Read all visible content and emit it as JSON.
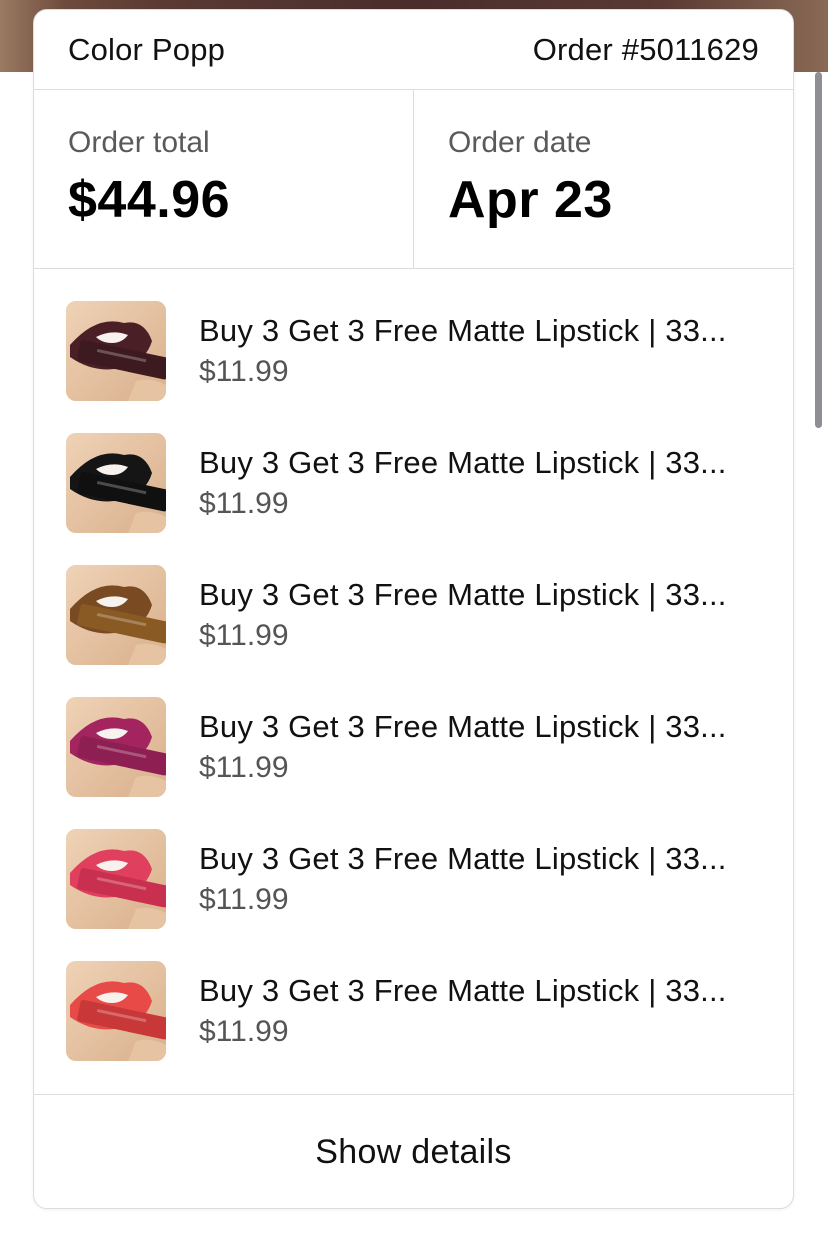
{
  "header": {
    "store_name": "Color Popp",
    "order_number": "Order #5011629"
  },
  "summary": {
    "total_label": "Order total",
    "total_value": "$44.96",
    "date_label": "Order date",
    "date_value": "Apr 23"
  },
  "items": [
    {
      "title": "Buy 3 Get 3 Free Matte Lipstick | 33...",
      "price": "$11.99",
      "lip_color": "#4a1f25",
      "tube_color": "#3d1a1f"
    },
    {
      "title": "Buy 3 Get 3 Free Matte Lipstick | 33...",
      "price": "$11.99",
      "lip_color": "#151515",
      "tube_color": "#101010"
    },
    {
      "title": "Buy 3 Get 3 Free Matte Lipstick | 33...",
      "price": "$11.99",
      "lip_color": "#7a4a22",
      "tube_color": "#8a5a25"
    },
    {
      "title": "Buy 3 Get 3 Free Matte Lipstick | 33...",
      "price": "$11.99",
      "lip_color": "#a3245e",
      "tube_color": "#8e1f52"
    },
    {
      "title": "Buy 3 Get 3 Free Matte Lipstick | 33...",
      "price": "$11.99",
      "lip_color": "#e0405e",
      "tube_color": "#c9304f"
    },
    {
      "title": "Buy 3 Get 3 Free Matte Lipstick | 33...",
      "price": "$11.99",
      "lip_color": "#e84a48",
      "tube_color": "#c93838"
    }
  ],
  "footer": {
    "show_details_label": "Show details"
  }
}
